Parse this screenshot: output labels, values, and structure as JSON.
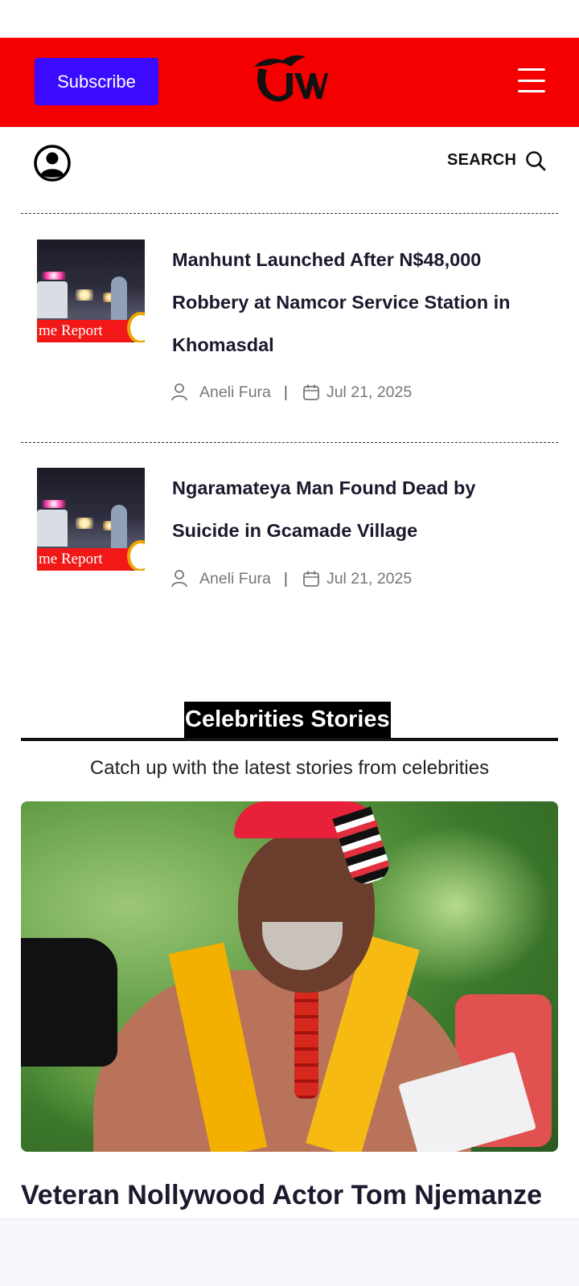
{
  "header": {
    "subscribe_label": "Subscribe",
    "logo_text": "UW",
    "bg_color": "#f50000",
    "button_color": "#3a0bff"
  },
  "toolbar": {
    "search_label": "SEARCH"
  },
  "articles": [
    {
      "title": "Manhunt Launched After N$48,000 Robbery at Namcor Service Station in Khomasdal",
      "thumb_caption": "me Report",
      "author": "Aneli Fura",
      "separator": "|",
      "date": "Jul 21, 2025"
    },
    {
      "title": "Ngaramateya Man Found Dead by Suicide in Gcamade Village",
      "thumb_caption": "me Report",
      "author": "Aneli Fura",
      "separator": "|",
      "date": "Jul 21, 2025"
    }
  ],
  "celebrities": {
    "heading": "Celebrities Stories",
    "subtitle": "Catch up with the latest stories from celebrities",
    "featured_headline": "Veteran Nollywood Actor Tom Njemanze"
  }
}
